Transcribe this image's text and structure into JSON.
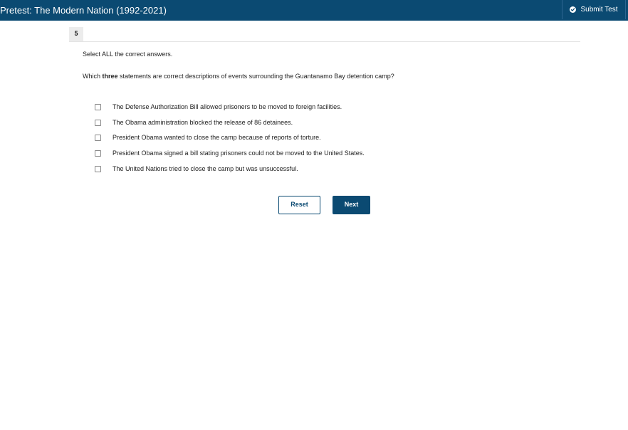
{
  "header": {
    "title": "Pretest: The Modern Nation (1992-2021)",
    "submit_label": "Submit Test",
    "submit_icon": "check-circle-icon"
  },
  "question": {
    "number": "5",
    "instruction": "Select ALL the correct answers.",
    "prompt_prefix": "Which ",
    "prompt_emphasis": "three",
    "prompt_suffix": " statements are correct descriptions of events surrounding the Guantanamo Bay detention camp?",
    "options": [
      {
        "label": "The Defense Authorization Bill allowed prisoners to be moved to foreign facilities.",
        "checked": false
      },
      {
        "label": "The Obama administration blocked the release of 86 detainees.",
        "checked": false
      },
      {
        "label": "President Obama wanted to close the camp because of reports of torture.",
        "checked": false
      },
      {
        "label": "President Obama signed a bill stating prisoners could not be moved to the United States.",
        "checked": false
      },
      {
        "label": "The United Nations tried to close the camp but was unsuccessful.",
        "checked": false
      }
    ]
  },
  "actions": {
    "reset_label": "Reset",
    "next_label": "Next"
  },
  "colors": {
    "brand": "#0b4a72",
    "background": "#ffffff"
  }
}
